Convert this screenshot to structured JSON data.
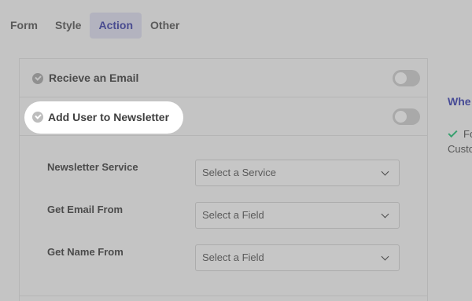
{
  "tabs": [
    {
      "label": "Form",
      "active": false
    },
    {
      "label": "Style",
      "active": false
    },
    {
      "label": "Action",
      "active": true
    },
    {
      "label": "Other",
      "active": false
    }
  ],
  "actions": [
    {
      "label": "Recieve an Email",
      "toggle_on": false
    },
    {
      "label": "Add User to Newsletter",
      "toggle_on": false,
      "highlighted": true
    }
  ],
  "newsletter_settings": [
    {
      "label": "Newsletter Service",
      "value": "Select a Service"
    },
    {
      "label": "Get Email From",
      "value": "Select a Field"
    },
    {
      "label": "Get Name From",
      "value": "Select a Field"
    }
  ],
  "side_panel": {
    "title": "Whe",
    "item": "Fo",
    "sub": "Custo"
  },
  "colors": {
    "accent": "#474b96",
    "check": "#38a06f",
    "overlay": "#c4c4c4"
  },
  "icons": [
    "check-circle-icon",
    "chevron-down-icon",
    "checkmark-icon"
  ]
}
